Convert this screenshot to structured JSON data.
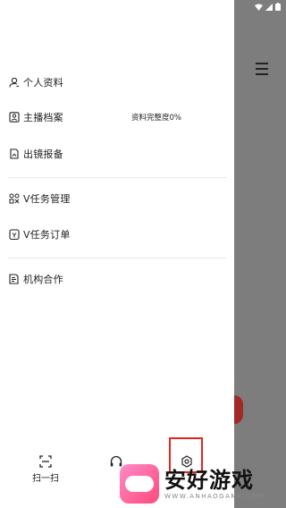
{
  "menu": {
    "group1": [
      {
        "label": "个人资料",
        "icon": "user-icon"
      },
      {
        "label": "主播档案",
        "icon": "profile-card-icon"
      },
      {
        "label": "出镜报备",
        "icon": "document-icon"
      }
    ],
    "group2": [
      {
        "label": "V任务管理",
        "icon": "apps-icon"
      },
      {
        "label": "V任务订单",
        "icon": "order-icon"
      }
    ],
    "group3": [
      {
        "label": "机构合作",
        "icon": "list-document-icon"
      }
    ]
  },
  "profile_status": "资料完整度0%",
  "bottom": {
    "scan": "扫一扫",
    "support_icon": "headset-icon",
    "settings_icon": "settings-icon"
  },
  "watermark": {
    "title": "安好游戏",
    "subtitle": "WWW.ANHAOGAME.COM"
  },
  "colors": {
    "highlight": "#e0261d",
    "overlay": "#7d7d7d"
  }
}
